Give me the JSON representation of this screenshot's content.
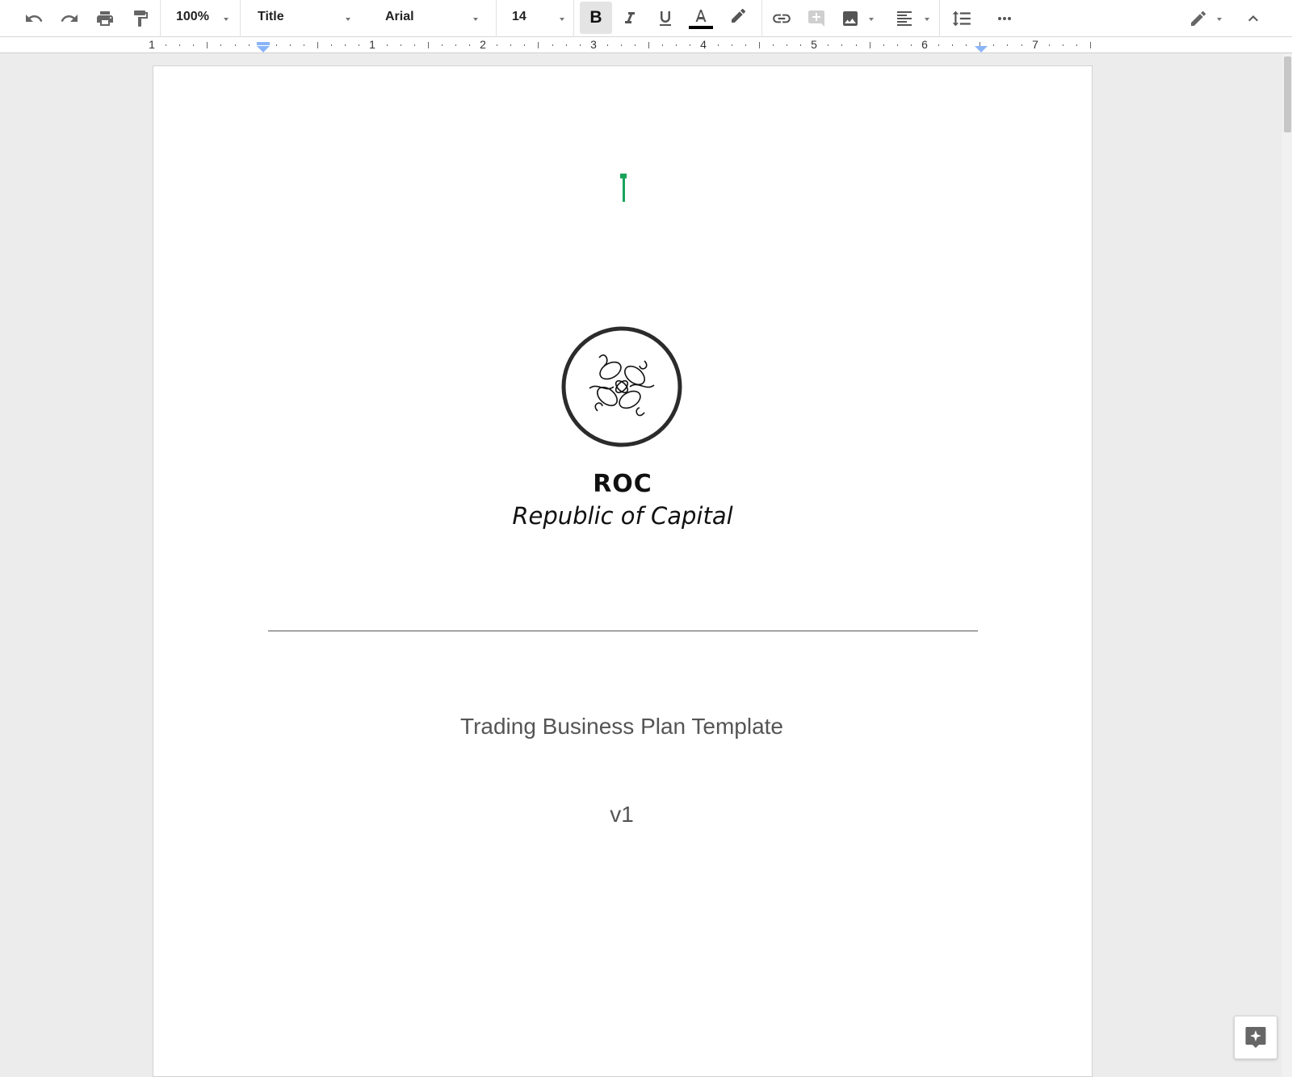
{
  "toolbar": {
    "zoom": "100%",
    "style": "Title",
    "font": "Arial",
    "font_size": "14",
    "bold_label": "B",
    "text_color": "#000000"
  },
  "icons": {
    "undo": "undo-icon",
    "redo": "redo-icon",
    "print": "print-icon",
    "paint_format": "paint-format-icon",
    "italic": "italic-icon",
    "underline": "underline-icon",
    "text_color": "text-color-icon",
    "highlight": "highlight-icon",
    "link": "link-icon",
    "comment": "add-comment-icon",
    "image": "insert-image-icon",
    "align": "align-left-icon",
    "line_spacing": "line-spacing-icon",
    "more": "more-icon",
    "editing_mode": "pencil-icon",
    "collapse": "chevron-up-icon",
    "explore": "explore-icon"
  },
  "ruler": {
    "labels": [
      "1",
      "1",
      "2",
      "3",
      "4",
      "5",
      "6",
      "7"
    ]
  },
  "document": {
    "brand_name": "ROC",
    "brand_tagline": "Republic of Capital",
    "title": "Trading Business Plan Template",
    "version": "v1"
  },
  "colors": {
    "cursor": "#18a45a",
    "indent_marker": "#8ab4f8"
  }
}
